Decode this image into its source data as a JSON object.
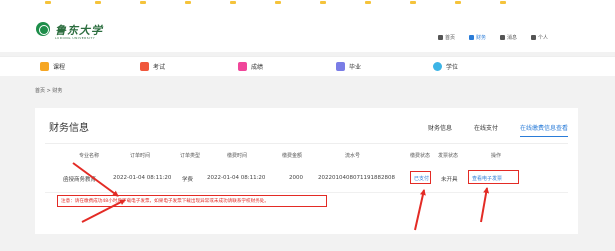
{
  "logo": {
    "name_cn": "鲁东大学",
    "name_en": "LUDONG UNIVERSITY"
  },
  "top_links": [
    {
      "label": "首页",
      "icon": "home-icon",
      "active": false
    },
    {
      "label": "财务",
      "icon": "finance-icon",
      "active": true
    },
    {
      "label": "消息",
      "icon": "bell-icon",
      "active": false
    },
    {
      "label": "个人",
      "icon": "user-icon",
      "active": false
    }
  ],
  "nav": [
    {
      "label": "课程",
      "icon": "course-icon",
      "color": "#f6a623"
    },
    {
      "label": "考试",
      "icon": "exam-icon",
      "color": "#f0573c"
    },
    {
      "label": "成绩",
      "icon": "score-icon",
      "color": "#f0469a"
    },
    {
      "label": "毕业",
      "icon": "graduate-icon",
      "color": "#7a7de6"
    },
    {
      "label": "学位",
      "icon": "degree-icon",
      "color": "#3cb4e6"
    }
  ],
  "breadcrumb": "首页 > 财务",
  "card": {
    "title": "财务信息",
    "tabs": [
      {
        "label": "财务信息",
        "active": false
      },
      {
        "label": "在线支付",
        "active": false
      },
      {
        "label": "在线缴费信息查看",
        "active": true
      }
    ]
  },
  "table": {
    "headers": [
      "专业名称",
      "订单时间",
      "订单类型",
      "缴费时间",
      "缴费金额",
      "流水号",
      "缴费状态",
      "发票状态",
      "操作"
    ],
    "rows": [
      {
        "major": "函授商务教育",
        "order_time": "2022-01-04 08:11:20",
        "order_type": "学费",
        "pay_time": "2022-01-04 08:11:20",
        "amount": "2000",
        "serial": "2022010408071191882808",
        "pay_status": "已支付",
        "invoice_status": "未开具",
        "action": "查看电子发票"
      }
    ]
  },
  "notice": "注意：请在缴费成功48小时后下载电子发票，如果电子发票下载出现异常或未成功请联系学校财务处。",
  "colors": {
    "accent": "#2a7cd8",
    "annotation_red": "#e32b25",
    "brand_green": "#1e8e4a"
  }
}
